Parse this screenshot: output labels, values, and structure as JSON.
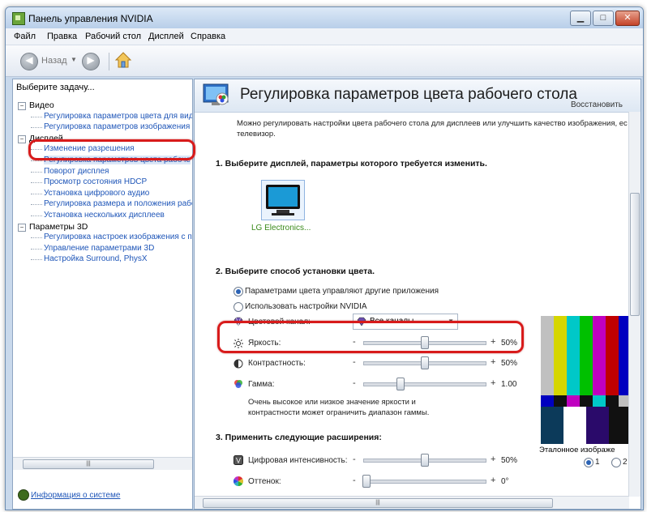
{
  "window": {
    "title": "Панель управления NVIDIA"
  },
  "menu": [
    "Файл",
    "Правка",
    "Рабочий стол",
    "Дисплей",
    "Справка"
  ],
  "toolbar": {
    "back_label": "Назад",
    "back_symbol": "◀",
    "forward_symbol": "▶"
  },
  "left": {
    "task_label": "Выберите задачу...",
    "tree": [
      {
        "label": "Видео",
        "level": 0,
        "expander": "−"
      },
      {
        "label": "Регулировка параметров цвета для вид",
        "level": 1
      },
      {
        "label": "Регулировка параметров изображения д",
        "level": 1
      },
      {
        "label": "Дисплей",
        "level": 0,
        "expander": "−"
      },
      {
        "label": "Изменение разрешения",
        "level": 1
      },
      {
        "label": "Регулировка параметров цвета рабоче",
        "level": 1,
        "selected": true
      },
      {
        "label": "Поворот дисплея",
        "level": 1
      },
      {
        "label": "Просмотр состояния HDCP",
        "level": 1
      },
      {
        "label": "Установка цифрового аудио",
        "level": 1
      },
      {
        "label": "Регулировка размера и положения рабо",
        "level": 1
      },
      {
        "label": "Установка нескольких дисплеев",
        "level": 1
      },
      {
        "label": "Параметры 3D",
        "level": 0,
        "expander": "−"
      },
      {
        "label": "Регулировка настроек изображения с пр",
        "level": 1
      },
      {
        "label": "Управление параметрами 3D",
        "level": 1
      },
      {
        "label": "Настройка Surround, PhysX",
        "level": 1
      }
    ],
    "system_info": "Информация о системе"
  },
  "main": {
    "title": "Регулировка параметров цвета рабочего стола",
    "restore": "Восстановить",
    "description": "Можно регулировать настройки цвета рабочего стола для дисплеев или улучшить качество изображения, ес телевизор.",
    "step1": "1. Выберите дисплей, параметры которого требуется изменить.",
    "display_name": "LG Electronics...",
    "step2": "2. Выберите способ установки цвета.",
    "radio_other": "Параметрами цвета управляют другие приложения",
    "radio_nvidia": "Использовать настройки NVIDIA",
    "channel_label": "Цветовой канал:",
    "channel_value": "Все каналы",
    "sliders": [
      {
        "label": "Яркость:",
        "minus": "-",
        "plus": "+",
        "value": "50%",
        "level": 0.5
      },
      {
        "label": "Контрастность:",
        "minus": "-",
        "plus": "+",
        "value": "50%",
        "level": 0.5
      },
      {
        "label": "Гамма:",
        "minus": "-",
        "plus": "+",
        "value": "1.00",
        "level": 0.3
      }
    ],
    "note": "Очень высокое или низкое значение яркости и контрастности может ограничить диапазон гаммы.",
    "step3": "3. Применить следующие расширения:",
    "ext_sliders": [
      {
        "label": "Цифровая интенсивность:",
        "minus": "-",
        "plus": "+",
        "value": "50%",
        "level": 0.5
      },
      {
        "label": "Оттенок:",
        "minus": "-",
        "plus": "+",
        "value": "0°",
        "level": 0.02
      }
    ],
    "reference_label": "Эталонное изображе",
    "ref_options": [
      "1",
      "2"
    ],
    "test_colors": [
      "#c0c0c0",
      "#d6d600",
      "#00c8c8",
      "#00c000",
      "#c000c0",
      "#c00000",
      "#0000c0"
    ]
  },
  "colors": {
    "highlight": "#d81b1b",
    "link": "#1f56b8",
    "selection": "#dbe7f7"
  }
}
